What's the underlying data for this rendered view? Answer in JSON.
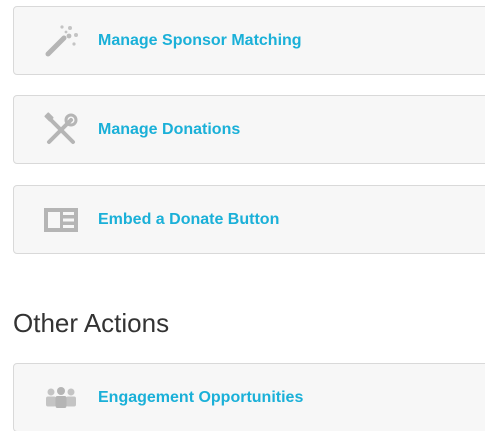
{
  "actions": [
    {
      "id": "sponsor",
      "label": "Manage Sponsor Matching",
      "icon": "magic-wand-icon"
    },
    {
      "id": "donations",
      "label": "Manage Donations",
      "icon": "tools-icon"
    },
    {
      "id": "embed",
      "label": "Embed a Donate Button",
      "icon": "embed-layout-icon"
    }
  ],
  "other_actions": {
    "heading": "Other Actions",
    "items": [
      {
        "id": "engage",
        "label": "Engagement Opportunities",
        "icon": "people-group-icon"
      }
    ]
  },
  "colors": {
    "link": "#1ab0d8",
    "icon": "#b5b5b5",
    "card_bg": "#f7f7f7",
    "card_border": "#d9d9d9",
    "heading": "#333333"
  }
}
